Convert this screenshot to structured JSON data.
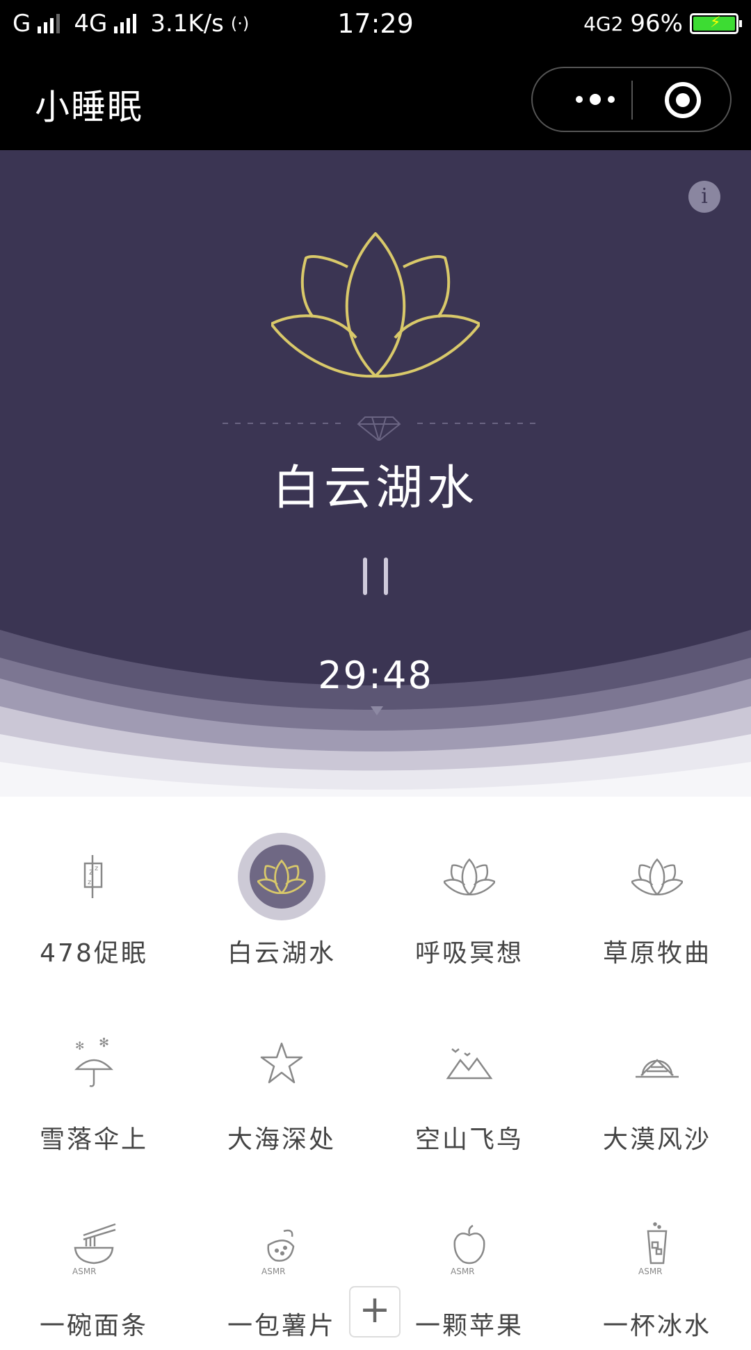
{
  "status_bar": {
    "carrier1": "G",
    "carrier2": "4G",
    "speed": "3.1K/s",
    "hotspot": "(·)",
    "time": "17:29",
    "network_right": "4G2",
    "battery": "96%"
  },
  "title_bar": {
    "app_title": "小睡眠"
  },
  "player": {
    "track_title": "白云湖水",
    "timer": "29:48",
    "info_label": "i"
  },
  "items": [
    {
      "label": "478促眠",
      "icon": "zzz-bed-icon",
      "active": false
    },
    {
      "label": "白云湖水",
      "icon": "lotus-icon",
      "active": true
    },
    {
      "label": "呼吸冥想",
      "icon": "lotus-icon",
      "active": false
    },
    {
      "label": "草原牧曲",
      "icon": "lotus-icon",
      "active": false
    },
    {
      "label": "雪落伞上",
      "icon": "snow-umbrella-icon",
      "active": false
    },
    {
      "label": "大海深处",
      "icon": "starfish-icon",
      "active": false
    },
    {
      "label": "空山飞鸟",
      "icon": "mountain-birds-icon",
      "active": false
    },
    {
      "label": "大漠风沙",
      "icon": "desert-sun-icon",
      "active": false
    },
    {
      "label": "一碗面条",
      "icon": "noodle-bowl-icon",
      "active": false,
      "badge": "ASMR"
    },
    {
      "label": "一包薯片",
      "icon": "chips-icon",
      "active": false,
      "badge": "ASMR"
    },
    {
      "label": "一颗苹果",
      "icon": "apple-icon",
      "active": false,
      "badge": "ASMR"
    },
    {
      "label": "一杯冰水",
      "icon": "ice-water-icon",
      "active": false,
      "badge": "ASMR"
    }
  ],
  "fab": {
    "label": "+"
  },
  "colors": {
    "hero_bg": "#3b3553",
    "lotus_gold": "#d9c96a",
    "active_ring": "#cdcad6",
    "active_inner": "#6f6884"
  }
}
